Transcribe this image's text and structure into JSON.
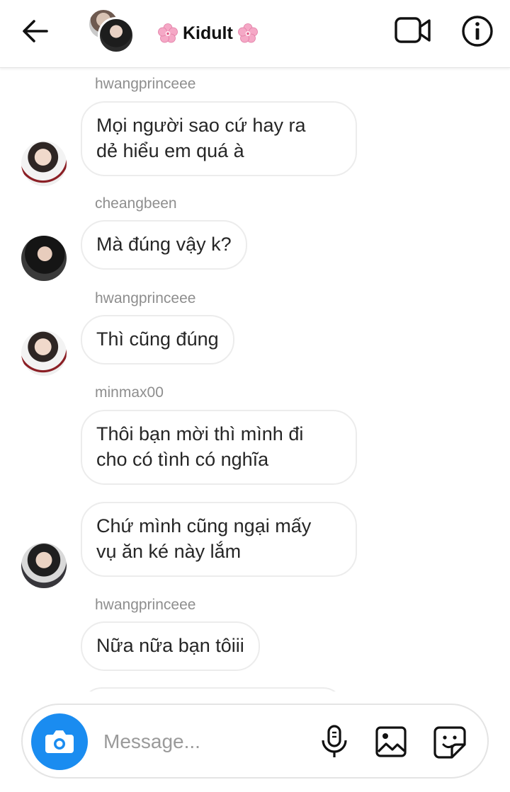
{
  "header": {
    "title": "Kidult",
    "icons": [
      "back-arrow-icon",
      "cherry-blossom-icon",
      "video-call-icon",
      "info-icon"
    ]
  },
  "messages": [
    {
      "sender": "hwangprinceee",
      "lines": [
        "Mọi người sao cứ hay ra",
        "dẻ hiểu em quá à"
      ]
    },
    {
      "sender": "cheangbeen",
      "lines": [
        "Mà đúng vậy k?"
      ]
    },
    {
      "sender": "hwangprinceee",
      "lines": [
        "Thì cũng đúng"
      ]
    },
    {
      "sender": "minmax00",
      "lines": [
        "Thôi bạn mời thì mình đi",
        "cho có tình có nghĩa"
      ]
    },
    {
      "sender": "",
      "lines": [
        "Chứ mình cũng ngại mấy",
        "vụ ăn ké này lắm"
      ]
    },
    {
      "sender": "hwangprinceee",
      "lines": [
        "Nữa nữa bạn tôiii"
      ]
    }
  ],
  "composer": {
    "placeholder": "Message...",
    "icons": [
      "camera-icon",
      "microphone-icon",
      "gallery-icon",
      "sticker-icon"
    ],
    "accent_color": "#1a8cf0"
  }
}
